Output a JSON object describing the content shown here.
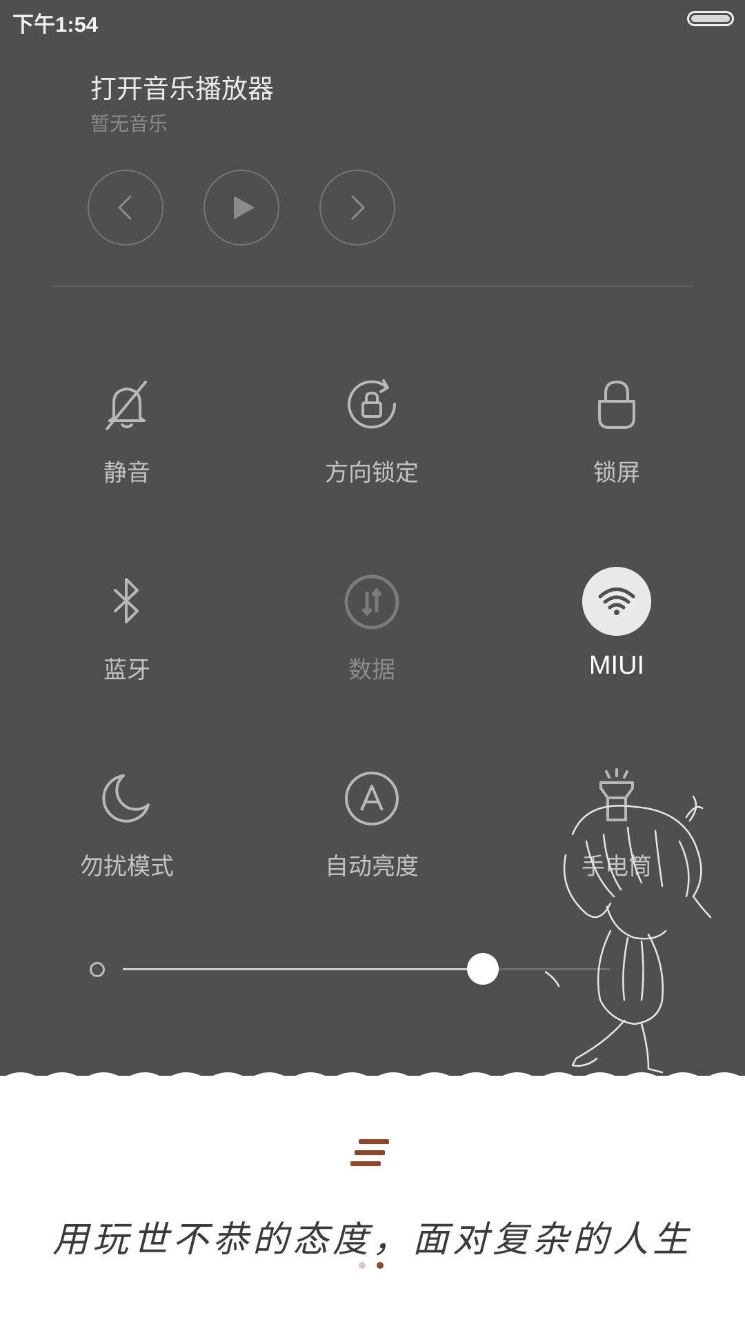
{
  "status_bar": {
    "time": "下午1:54"
  },
  "music": {
    "title": "打开音乐播放器",
    "subtitle": "暂无音乐",
    "controls": [
      "previous-icon",
      "play-icon",
      "next-icon"
    ]
  },
  "toggles": [
    {
      "id": "silent",
      "label": "静音",
      "icon": "bell-off-icon",
      "state": "off"
    },
    {
      "id": "rotation",
      "label": "方向锁定",
      "icon": "rotation-lock-icon",
      "state": "off"
    },
    {
      "id": "lock",
      "label": "锁屏",
      "icon": "lock-icon",
      "state": "off"
    },
    {
      "id": "bluetooth",
      "label": "蓝牙",
      "icon": "bluetooth-icon",
      "state": "off"
    },
    {
      "id": "data",
      "label": "数据",
      "icon": "data-icon",
      "state": "disabled"
    },
    {
      "id": "wifi",
      "label": "MIUI",
      "icon": "wifi-icon",
      "state": "on"
    },
    {
      "id": "dnd",
      "label": "勿扰模式",
      "icon": "moon-icon",
      "state": "off"
    },
    {
      "id": "auto_brightness",
      "label": "自动亮度",
      "icon": "auto-brightness-icon",
      "state": "off"
    },
    {
      "id": "flashlight",
      "label": "手电筒",
      "icon": "flashlight-icon",
      "state": "off"
    }
  ],
  "brightness": {
    "level": 0.74
  },
  "footer": {
    "quote": "用玩世不恭的态度，面对复杂的人生",
    "page_indicator": {
      "pages": 2,
      "current": 2
    }
  },
  "colors": {
    "background": "#4f4f4f",
    "accent_brown": "#8a4a30",
    "active_toggle": "#e9e9e9"
  }
}
